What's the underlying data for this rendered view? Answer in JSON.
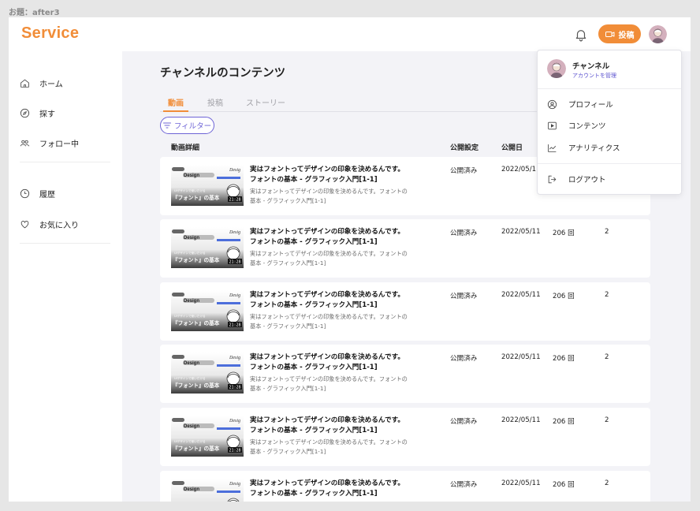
{
  "caption": "お題：after3",
  "colors": {
    "accent": "#f18d38",
    "brand": "#f18d38",
    "purple": "#6d63d6"
  },
  "header": {
    "logo": "Service",
    "post_button": "投稿",
    "bell_icon": "bell-icon",
    "avatar_icon": "avatar"
  },
  "sidebar": {
    "items": [
      {
        "label": "ホーム",
        "icon": "home-icon"
      },
      {
        "label": "探す",
        "icon": "compass-icon"
      },
      {
        "label": "フォロー中",
        "icon": "people-icon"
      },
      {
        "label": "履歴",
        "icon": "clock-icon"
      },
      {
        "label": "お気に入り",
        "icon": "heart-icon"
      }
    ]
  },
  "main": {
    "title": "チャンネルのコンテンツ",
    "tabs": [
      {
        "label": "動画",
        "active": true
      },
      {
        "label": "投稿",
        "active": false
      },
      {
        "label": "ストーリー",
        "active": false
      }
    ],
    "filter_label": "フィルター",
    "columns": {
      "detail": "動画詳細",
      "visibility": "公開設定",
      "date": "公開日"
    },
    "rows": [
      {
        "title1": "実はフォントってデザインの印象を決めるんです。",
        "title2": "フォントの基本 - グラフィック入門[1-1]",
        "desc1": "実はフォントってデザインの印象を決めるんです。フォントの",
        "desc2": "基本 - グラフィック入門[1-1]",
        "visibility": "公開済み",
        "date": "2022/05/1",
        "views": "",
        "comments": ""
      },
      {
        "title1": "実はフォントってデザインの印象を決めるんです。",
        "title2": "フォントの基本 - グラフィック入門[1-1]",
        "desc1": "実はフォントってデザインの印象を決めるんです。フォントの",
        "desc2": "基本 - グラフィック入門[1-1]",
        "visibility": "公開済み",
        "date": "2022/05/11",
        "views": "206 回",
        "comments": "2"
      },
      {
        "title1": "実はフォントってデザインの印象を決めるんです。",
        "title2": "フォントの基本 - グラフィック入門[1-1]",
        "desc1": "実はフォントってデザインの印象を決めるんです。フォントの",
        "desc2": "基本 - グラフィック入門[1-1]",
        "visibility": "公開済み",
        "date": "2022/05/11",
        "views": "206 回",
        "comments": "2"
      },
      {
        "title1": "実はフォントってデザインの印象を決めるんです。",
        "title2": "フォントの基本 - グラフィック入門[1-1]",
        "desc1": "実はフォントってデザインの印象を決めるんです。フォントの",
        "desc2": "基本 - グラフィック入門[1-1]",
        "visibility": "公開済み",
        "date": "2022/05/11",
        "views": "206 回",
        "comments": "2"
      },
      {
        "title1": "実はフォントってデザインの印象を決めるんです。",
        "title2": "フォントの基本 - グラフィック入門[1-1]",
        "desc1": "実はフォントってデザインの印象を決めるんです。フォントの",
        "desc2": "基本 - グラフィック入門[1-1]",
        "visibility": "公開済み",
        "date": "2022/05/11",
        "views": "206 回",
        "comments": "2"
      },
      {
        "title1": "実はフォントってデザインの印象を決めるんです。",
        "title2": "フォントの基本 - グラフィック入門[1-1]",
        "desc1": "",
        "desc2": "",
        "visibility": "公開済み",
        "date": "2022/05/11",
        "views": "206 回",
        "comments": "2"
      }
    ],
    "thumbnail": {
      "badge": "Design",
      "side_text": "Desig",
      "caption": "UIデザインで使いだける",
      "headline": "『フォント』の基本",
      "duration": "21:28"
    }
  },
  "dropdown": {
    "channel_name": "チャンネル",
    "manage_link": "アカウントを管理",
    "items": [
      {
        "label": "プロフィール",
        "icon": "profile-icon"
      },
      {
        "label": "コンテンツ",
        "icon": "play-icon"
      },
      {
        "label": "アナリティクス",
        "icon": "chart-icon"
      },
      {
        "label": "ログアウト",
        "icon": "logout-icon"
      }
    ]
  }
}
